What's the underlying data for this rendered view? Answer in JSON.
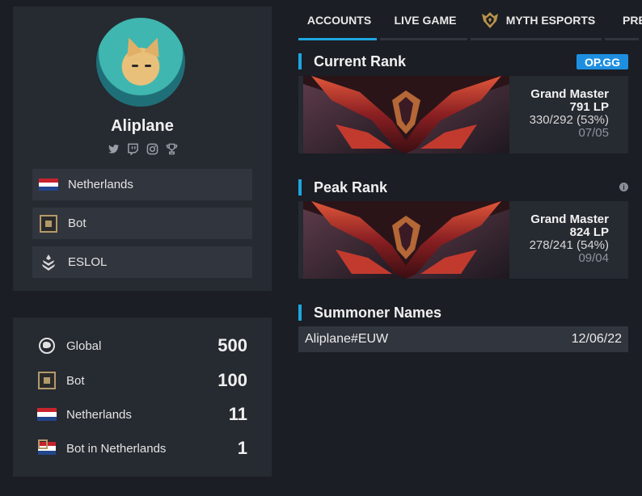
{
  "profile": {
    "name": "Aliplane",
    "socials": [
      "twitter-icon",
      "twitch-icon",
      "instagram-icon",
      "trophy-icon"
    ],
    "rows": [
      {
        "label": "Netherlands",
        "icon": "netherlands-flag-icon"
      },
      {
        "label": "Bot",
        "icon": "bot-role-icon"
      },
      {
        "label": "ESLOL",
        "icon": "eslol-logo-icon"
      }
    ]
  },
  "rankings": [
    {
      "label": "Global",
      "value": "500",
      "icon": "globe-icon"
    },
    {
      "label": "Bot",
      "value": "100",
      "icon": "bot-role-icon"
    },
    {
      "label": "Netherlands",
      "value": "11",
      "icon": "netherlands-flag-icon"
    },
    {
      "label": "Bot in Netherlands",
      "value": "1",
      "icon": "bot-netherlands-icon"
    }
  ],
  "tabs": [
    {
      "label": "ACCOUNTS",
      "active": true
    },
    {
      "label": "LIVE GAME",
      "active": false
    },
    {
      "label": "MYTH ESPORTS",
      "active": false
    },
    {
      "label": "PRE",
      "active": false
    }
  ],
  "current_rank": {
    "title": "Current Rank",
    "badge": "OP.GG",
    "tier": "Grand Master",
    "lp": "791 LP",
    "record": "330/292 (53%)",
    "date": "07/05"
  },
  "peak_rank": {
    "title": "Peak Rank",
    "tier": "Grand Master",
    "lp": "824 LP",
    "record": "278/241 (54%)",
    "date": "09/04"
  },
  "summoner_names": {
    "title": "Summoner Names",
    "items": [
      {
        "name": "Aliplane#EUW",
        "date": "12/06/22"
      }
    ]
  },
  "colors": {
    "accent": "#1ea6e0",
    "opgg": "#1e8fe0",
    "background": "#1b1e24",
    "panel": "#262a31",
    "row": "#31353d"
  }
}
